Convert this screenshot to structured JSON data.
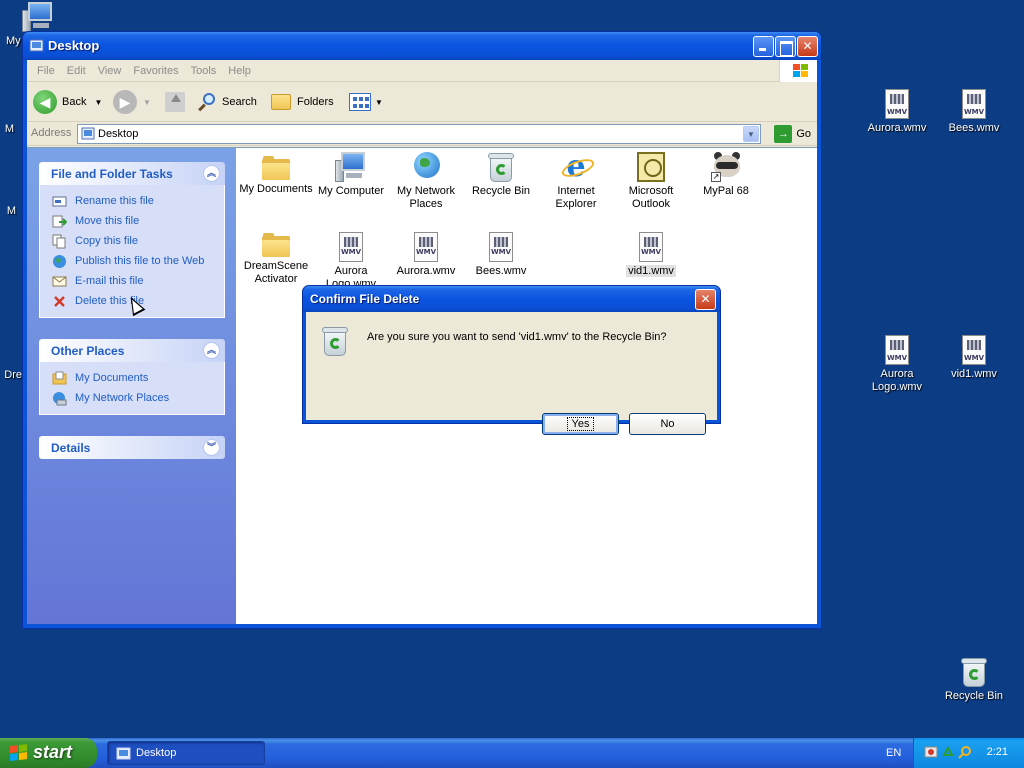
{
  "desktop": {
    "left_icons": [
      {
        "label": "My",
        "kind": "computer"
      },
      {
        "label": "M",
        "kind": "folder"
      },
      {
        "label": "M",
        "kind": "globe"
      },
      {
        "label": "Dre",
        "kind": "folder"
      }
    ],
    "right_icons": [
      {
        "label": "Aurora.wmv",
        "kind": "wmv"
      },
      {
        "label": "Bees.wmv",
        "kind": "wmv"
      },
      {
        "label": "Aurora Logo.wmv",
        "kind": "wmv"
      },
      {
        "label": "vid1.wmv",
        "kind": "wmv"
      },
      {
        "label": "Recycle Bin",
        "kind": "recycle-bin"
      }
    ],
    "background_color": "#0c3c84"
  },
  "window": {
    "title": "Desktop",
    "menu": [
      "File",
      "Edit",
      "View",
      "Favorites",
      "Tools",
      "Help"
    ],
    "toolbar": {
      "back_label": "Back",
      "search_label": "Search",
      "folders_label": "Folders"
    },
    "address": {
      "label": "Address",
      "value": "Desktop",
      "go_label": "Go"
    },
    "sidebar": {
      "file_tasks": {
        "title": "File and Folder Tasks",
        "items": [
          {
            "label": "Rename this file",
            "icon": "rename-icon"
          },
          {
            "label": "Move this file",
            "icon": "move-icon"
          },
          {
            "label": "Copy this file",
            "icon": "copy-icon"
          },
          {
            "label": "Publish this file to the Web",
            "icon": "globe-icon"
          },
          {
            "label": "E-mail this file",
            "icon": "email-icon"
          },
          {
            "label": "Delete this file",
            "icon": "delete-icon"
          }
        ]
      },
      "other_places": {
        "title": "Other Places",
        "items": [
          {
            "label": "My Documents",
            "icon": "folder-icon"
          },
          {
            "label": "My Network Places",
            "icon": "network-icon"
          }
        ]
      },
      "details": {
        "title": "Details"
      }
    },
    "files": [
      {
        "label": "My Documents",
        "kind": "documents"
      },
      {
        "label": "My Computer",
        "kind": "computer"
      },
      {
        "label": "My Network Places",
        "kind": "network"
      },
      {
        "label": "Recycle Bin",
        "kind": "recycle-bin"
      },
      {
        "label": "Internet Explorer",
        "kind": "ie"
      },
      {
        "label": "Microsoft Outlook",
        "kind": "outlook"
      },
      {
        "label": "MyPal 68",
        "kind": "raccoon"
      },
      {
        "label": "DreamScene Activator",
        "kind": "folder"
      },
      {
        "label": "Aurora Logo.wmv",
        "kind": "wmv"
      },
      {
        "label": "Aurora.wmv",
        "kind": "wmv"
      },
      {
        "label": "Bees.wmv",
        "kind": "wmv"
      },
      {
        "label": "vid1.wmv",
        "kind": "wmv",
        "selected": true
      }
    ]
  },
  "dialog": {
    "title": "Confirm File Delete",
    "message": "Are you sure you want to send 'vid1.wmv' to the Recycle Bin?",
    "yes_label": "Yes",
    "no_label": "No"
  },
  "taskbar": {
    "start_label": "start",
    "task_label": "Desktop",
    "language": "EN",
    "clock": "2:21"
  }
}
